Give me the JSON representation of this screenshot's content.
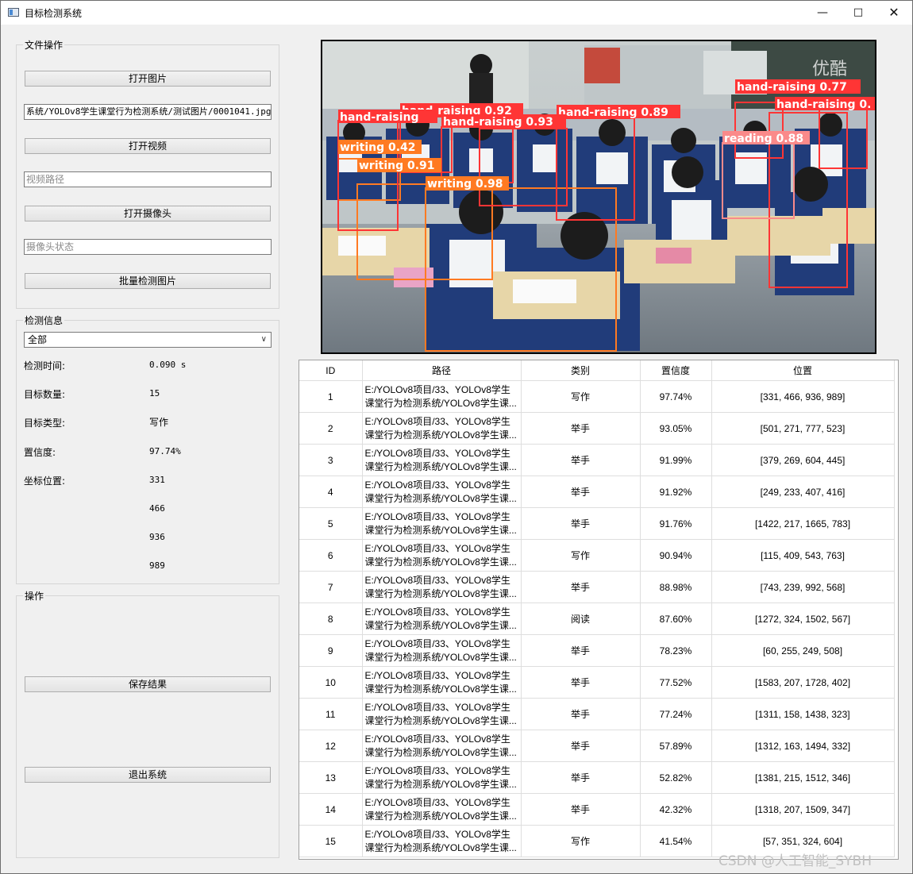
{
  "window": {
    "title": "目标检测系统"
  },
  "file_ops": {
    "group_title": "文件操作",
    "open_image_label": "打开图片",
    "image_path_value": "系统/YOLOv8学生课堂行为检测系统/测试图片/0001041.jpg",
    "open_video_label": "打开视频",
    "video_path_placeholder": "视频路径",
    "open_camera_label": "打开摄像头",
    "camera_status_placeholder": "摄像头状态",
    "batch_detect_label": "批量检测图片"
  },
  "detect_info": {
    "group_title": "检测信息",
    "filter_selected": "全部",
    "time_label": "检测时间:",
    "time_value": "0.090 s",
    "count_label": "目标数量:",
    "count_value": "15",
    "type_label": "目标类型:",
    "type_value": "写作",
    "conf_label": "置信度:",
    "conf_value": "97.74%",
    "coord_label": "坐标位置:",
    "coords": [
      "331",
      "466",
      "936",
      "989"
    ]
  },
  "actions": {
    "group_title": "操作",
    "save_label": "保存结果",
    "exit_label": "退出系统"
  },
  "detections_overlay": [
    {
      "label": "hand-raising 0.77",
      "color": "#ff3535"
    },
    {
      "label": "hand-raising 0.92",
      "color": "#ff3535"
    },
    {
      "label": "hand-raising 0.89",
      "color": "#ff3535"
    },
    {
      "label": "hand-raising 0.93",
      "color": "#ff3535"
    },
    {
      "label": "hand-raising",
      "color": "#ff3535"
    },
    {
      "label": "hand-raising 0.",
      "color": "#ff3535"
    },
    {
      "label": "reading 0.88",
      "color": "#fa8a8a"
    },
    {
      "label": "writing 0.42",
      "color": "#ff7a22"
    },
    {
      "label": "writing 0.91",
      "color": "#ff7a22"
    },
    {
      "label": "writing 0.98",
      "color": "#ff7a22"
    },
    {
      "label": "优酷",
      "color": "#ffffff"
    }
  ],
  "table": {
    "headers": [
      "ID",
      "路径",
      "类别",
      "置信度",
      "位置"
    ],
    "path_line1": "E:/YOLOv8项目/33、YOLOv8学生",
    "path_line2": "课堂行为检测系统/YOLOv8学生课...",
    "rows": [
      {
        "id": "1",
        "cls": "写作",
        "conf": "97.74%",
        "pos": "[331, 466, 936, 989]"
      },
      {
        "id": "2",
        "cls": "举手",
        "conf": "93.05%",
        "pos": "[501, 271, 777, 523]"
      },
      {
        "id": "3",
        "cls": "举手",
        "conf": "91.99%",
        "pos": "[379, 269, 604, 445]"
      },
      {
        "id": "4",
        "cls": "举手",
        "conf": "91.92%",
        "pos": "[249, 233, 407, 416]"
      },
      {
        "id": "5",
        "cls": "举手",
        "conf": "91.76%",
        "pos": "[1422, 217, 1665, 783]"
      },
      {
        "id": "6",
        "cls": "写作",
        "conf": "90.94%",
        "pos": "[115, 409, 543, 763]"
      },
      {
        "id": "7",
        "cls": "举手",
        "conf": "88.98%",
        "pos": "[743, 239, 992, 568]"
      },
      {
        "id": "8",
        "cls": "阅读",
        "conf": "87.60%",
        "pos": "[1272, 324, 1502, 567]"
      },
      {
        "id": "9",
        "cls": "举手",
        "conf": "78.23%",
        "pos": "[60, 255, 249, 508]"
      },
      {
        "id": "10",
        "cls": "举手",
        "conf": "77.52%",
        "pos": "[1583, 207, 1728, 402]"
      },
      {
        "id": "11",
        "cls": "举手",
        "conf": "77.24%",
        "pos": "[1311, 158, 1438, 323]"
      },
      {
        "id": "12",
        "cls": "举手",
        "conf": "57.89%",
        "pos": "[1312, 163, 1494, 332]"
      },
      {
        "id": "13",
        "cls": "举手",
        "conf": "52.82%",
        "pos": "[1381, 215, 1512, 346]"
      },
      {
        "id": "14",
        "cls": "举手",
        "conf": "42.32%",
        "pos": "[1318, 207, 1509, 347]"
      },
      {
        "id": "15",
        "cls": "写作",
        "conf": "41.54%",
        "pos": "[57, 351, 324, 604]"
      }
    ]
  },
  "watermark": "CSDN @人工智能_SYBH"
}
